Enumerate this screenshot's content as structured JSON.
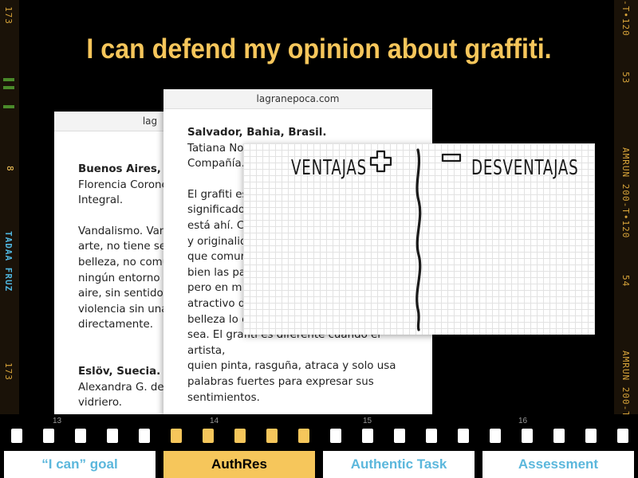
{
  "title": "I can defend my opinion about graffiti.",
  "film_left": [
    "173",
    "TADAA FRUZ",
    "8",
    "173"
  ],
  "film_right": [
    "-T•120",
    "53",
    "AMRUN 200-T•120",
    "54",
    "AMRUN 200-T"
  ],
  "card1": {
    "url": "lag",
    "city": "Buenos Aires, A",
    "author": "Florencia Corone\nIntegral.",
    "text": "Vandalismo. Van\narte, no tiene se\nbelleza, no comu\nningún entorno\naire, sin sentido\nviolencia sin una\ndirectamente.",
    "city2": "Eslöv, Suecia.",
    "author2": "Alexandra G. de\nvidriero."
  },
  "card2": {
    "url": "lagranepoca.com",
    "city": "Salvador, Bahia, Brasil.",
    "author": "Tatiana No\nCompañía.",
    "text": "El grafiti es\nsignificado\nestá ahí. C\ny originalid\nque comur\nbien las pa\npero en m\natractivo d\nbelleza lo c\nsea. El grafiti es diferente cuando el artista,\nquien pinta, rasguña, atraca y solo usa\npalabras fuertes para expresar sus\nsentimientos."
  },
  "panel": {
    "left": "VENTAJAS",
    "right": "DESVENTAJAS"
  },
  "frame_numbers": [
    "13",
    "14",
    "15",
    "16"
  ],
  "tabs": [
    "“I can” goal",
    "AuthRes",
    "Authentic Task",
    "Assessment"
  ],
  "active_tab": "AuthRes",
  "colors": {
    "accent": "#f6c65b",
    "tab_text": "#5bb7dc"
  }
}
